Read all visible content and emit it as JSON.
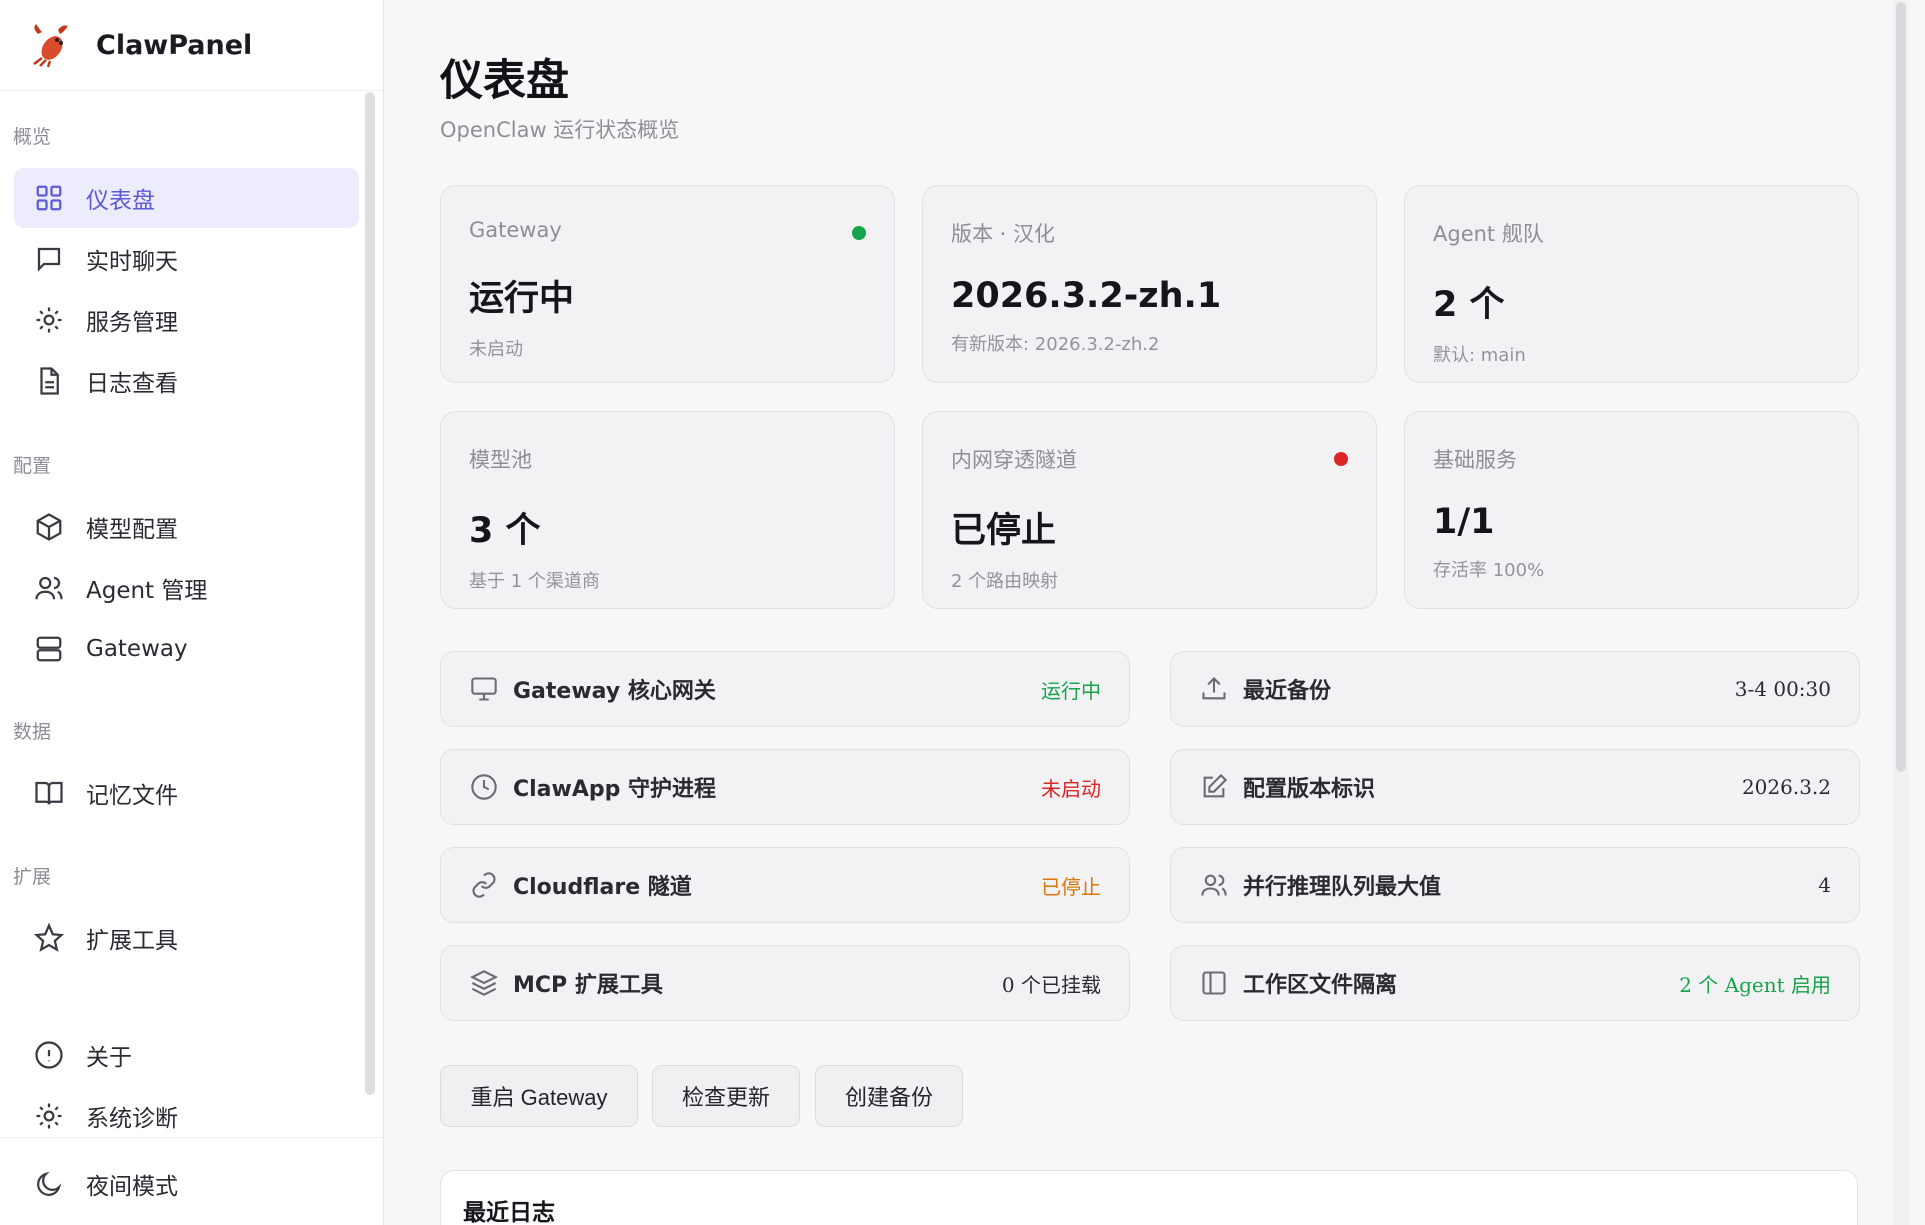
{
  "app": {
    "name": "ClawPanel"
  },
  "sidebar": {
    "sections": [
      {
        "label": "概览"
      },
      {
        "label": "配置"
      },
      {
        "label": "数据"
      },
      {
        "label": "扩展"
      }
    ],
    "items": [
      {
        "label": "仪表盘",
        "icon": "grid-icon",
        "active": true
      },
      {
        "label": "实时聊天",
        "icon": "chat-icon"
      },
      {
        "label": "服务管理",
        "icon": "sun-icon"
      },
      {
        "label": "日志查看",
        "icon": "file-icon"
      },
      {
        "label": "模型配置",
        "icon": "cube-icon"
      },
      {
        "label": "Agent 管理",
        "icon": "users-icon"
      },
      {
        "label": "Gateway",
        "icon": "server-icon"
      },
      {
        "label": "记忆文件",
        "icon": "book-icon"
      },
      {
        "label": "扩展工具",
        "icon": "star-icon"
      },
      {
        "label": "关于",
        "icon": "info-icon"
      },
      {
        "label": "系统诊断",
        "icon": "sun-icon"
      }
    ],
    "night_mode": {
      "label": "夜间模式",
      "icon": "moon-icon"
    }
  },
  "header": {
    "title": "仪表盘",
    "subtitle": "OpenClaw 运行状态概览"
  },
  "cards": [
    {
      "label": "Gateway",
      "value": "运行中",
      "meta": "未启动",
      "status_color": "#16a34a"
    },
    {
      "label": "版本 · 汉化",
      "value": "2026.3.2-zh.1",
      "meta": "有新版本: 2026.3.2-zh.2"
    },
    {
      "label": "Agent 舰队",
      "value": "2 个",
      "meta": "默认: main"
    },
    {
      "label": "模型池",
      "value": "3 个",
      "meta": "基于 1 个渠道商"
    },
    {
      "label": "内网穿透隧道",
      "value": "已停止",
      "meta": "2 个路由映射",
      "status_color": "#dc2626"
    },
    {
      "label": "基础服务",
      "value": "1/1",
      "meta": "存活率 100%"
    }
  ],
  "left_rows": [
    {
      "label": "Gateway 核心网关",
      "value": "运行中",
      "color": "#16a34a",
      "icon": "monitor-icon"
    },
    {
      "label": "ClawApp 守护进程",
      "value": "未启动",
      "color": "#dc2626",
      "icon": "clock-icon"
    },
    {
      "label": "Cloudflare 隧道",
      "value": "已停止",
      "color": "#d97706",
      "icon": "link-icon"
    },
    {
      "label": "MCP 扩展工具",
      "value": "0 个已挂载",
      "color": "#2a2a33",
      "icon": "layers-icon"
    }
  ],
  "right_rows": [
    {
      "label": "最近备份",
      "value": "3-4 00:30",
      "color": "#2a2a33",
      "icon": "upload-icon"
    },
    {
      "label": "配置版本标识",
      "value": "2026.3.2",
      "color": "#2a2a33",
      "icon": "edit-icon"
    },
    {
      "label": "并行推理队列最大值",
      "value": "4",
      "color": "#2a2a33",
      "icon": "users-icon"
    },
    {
      "label": "工作区文件隔离",
      "value": "2 个 Agent 启用",
      "color": "#16a34a",
      "icon": "sidebar-icon"
    }
  ],
  "actions": {
    "restart": "重启 Gateway",
    "check_update": "检查更新",
    "backup": "创建备份"
  },
  "logs": {
    "title": "最近日志"
  }
}
